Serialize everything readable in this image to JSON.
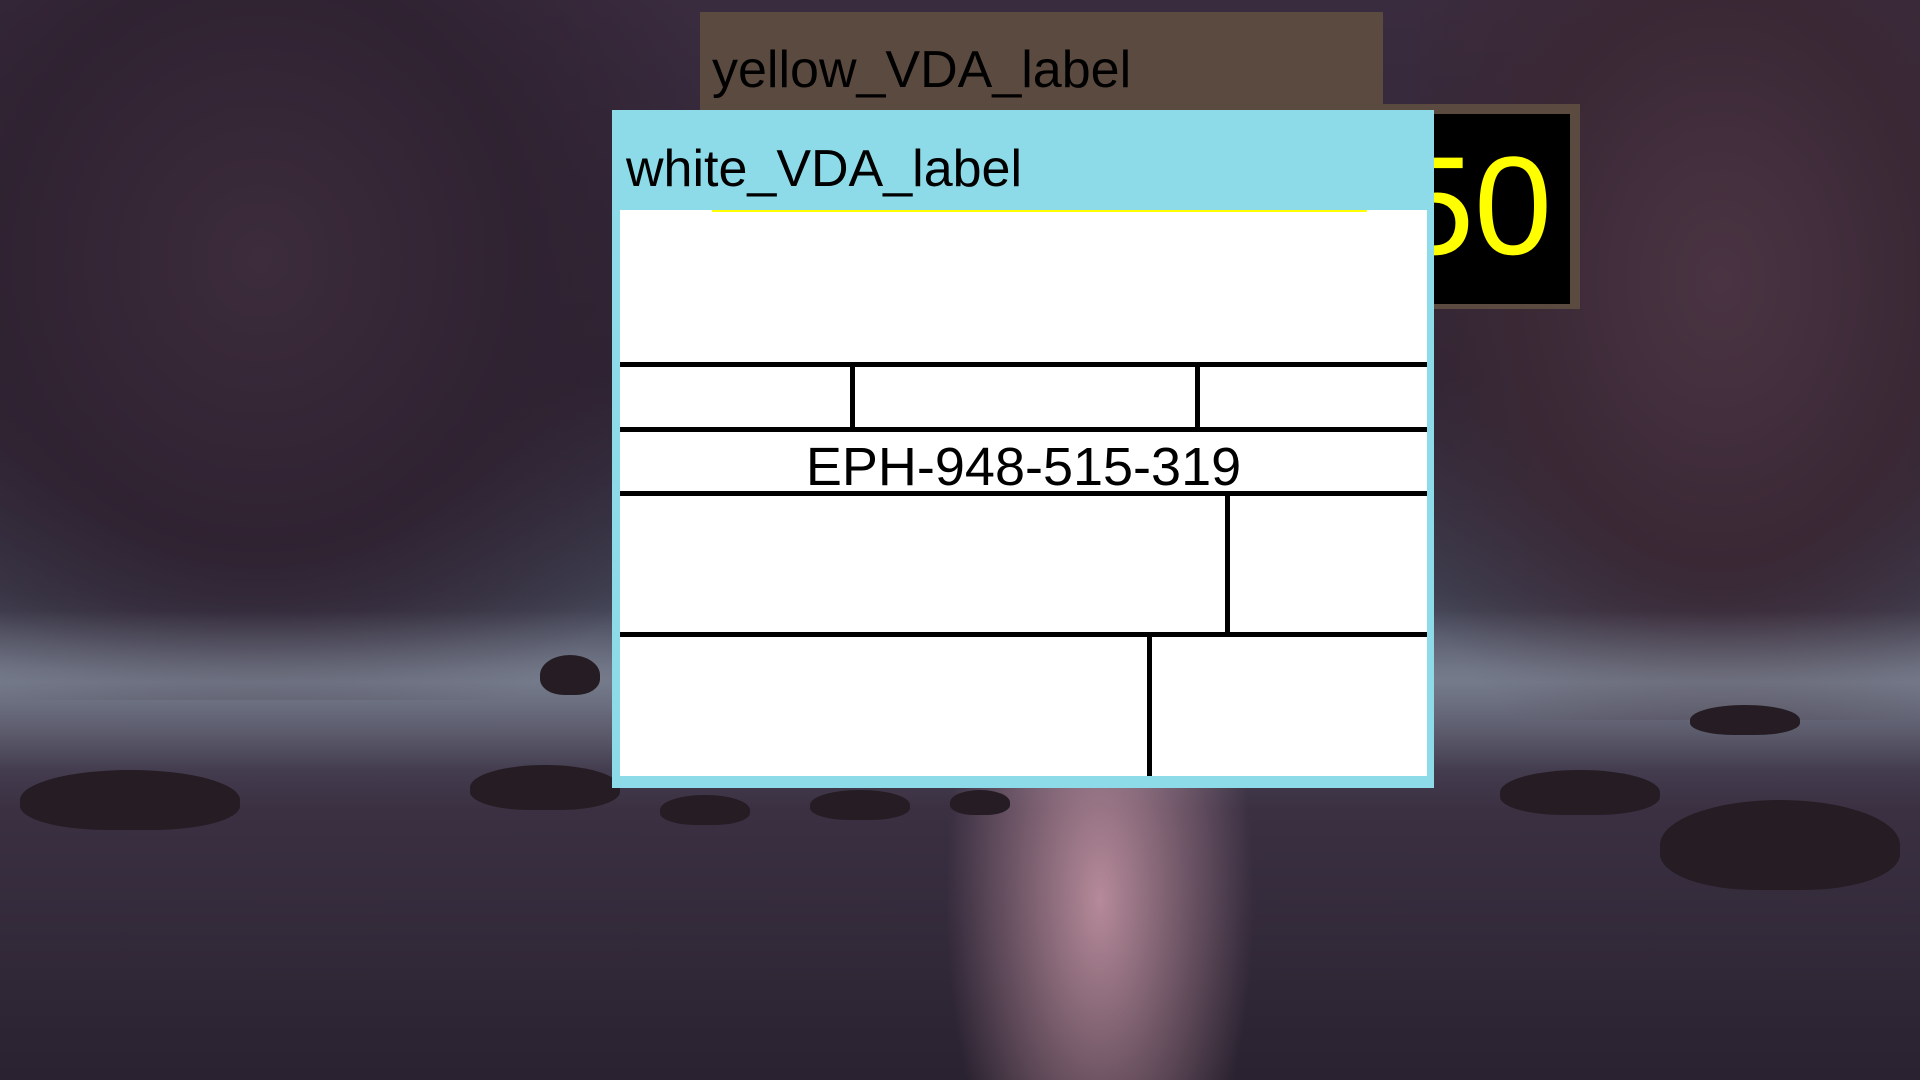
{
  "windows": {
    "yellow_label": {
      "title": "yellow_VDA_label"
    },
    "counter": {
      "value": "50"
    },
    "white_label": {
      "title": "white_VDA_label",
      "form": {
        "identifier": "EPH-948-515-319"
      }
    }
  },
  "colors": {
    "yellow_window_bg": "#5b4a40",
    "white_window_bg": "#8ddbe8",
    "counter_text": "#ffff00",
    "counter_bg": "#000000",
    "form_bg": "#ffffff"
  }
}
